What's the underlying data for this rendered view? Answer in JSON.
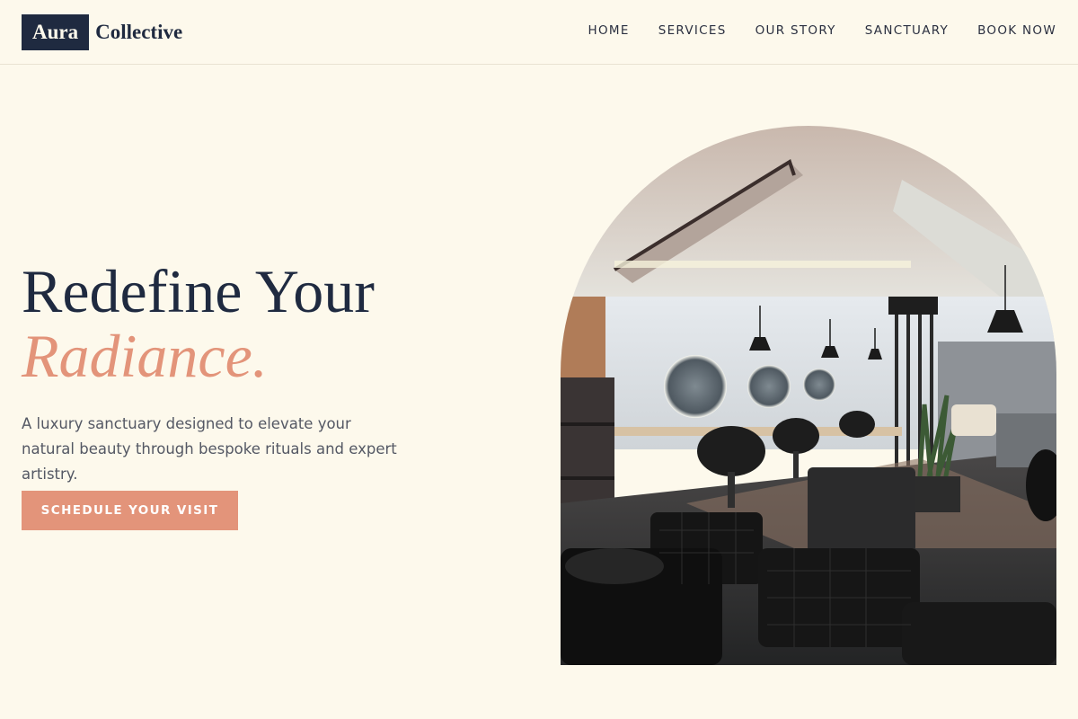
{
  "brand": {
    "logo_box": "Aura",
    "logo_text": "Collective"
  },
  "nav": {
    "items": [
      "HOME",
      "SERVICES",
      "OUR STORY",
      "SANCTUARY",
      "BOOK NOW"
    ]
  },
  "hero": {
    "title_line1": "Redefine Your",
    "title_line2": "Radiance.",
    "subtitle": "A luxury sanctuary designed to elevate your natural beauty through bespoke rituals and expert artistry.",
    "cta_label": "SCHEDULE YOUR VISIT",
    "image_desc": "salon-interior-photo"
  },
  "colors": {
    "navy": "#1f2a40",
    "accent": "#e3947a",
    "background": "#fdf9ec"
  }
}
